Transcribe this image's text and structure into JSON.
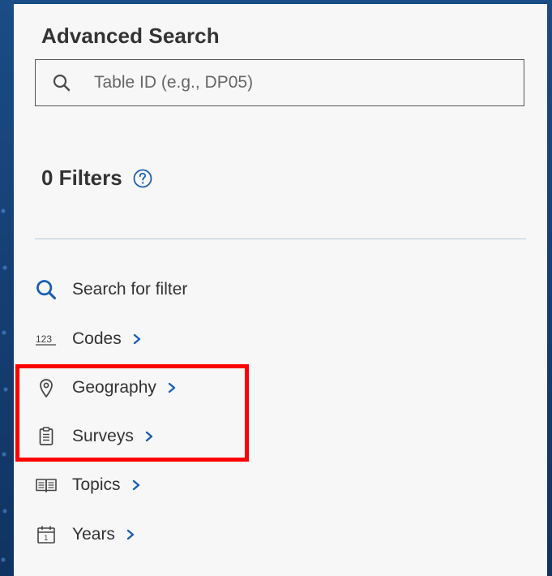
{
  "panel": {
    "title": "Advanced Search"
  },
  "search": {
    "placeholder": "Table ID (e.g., DP05)",
    "value": "",
    "icon": "search-icon"
  },
  "filters": {
    "heading": "0 Filters",
    "help_icon": "help-circle-icon"
  },
  "filter_items": [
    {
      "label": "Search for filter",
      "icon": "search-icon",
      "has_chevron": false
    },
    {
      "label": "Codes",
      "icon": "numeric-codes-icon",
      "has_chevron": true
    },
    {
      "label": "Geography",
      "icon": "map-pin-icon",
      "has_chevron": true
    },
    {
      "label": "Surveys",
      "icon": "clipboard-icon",
      "has_chevron": true
    },
    {
      "label": "Topics",
      "icon": "open-book-icon",
      "has_chevron": true
    },
    {
      "label": "Years",
      "icon": "calendar-icon",
      "has_chevron": true
    }
  ],
  "codes_icon_text": "123",
  "calendar_icon_text": "1",
  "colors": {
    "accent_blue": "#1a5fb4",
    "text": "#333333",
    "highlight_red": "#ff0000",
    "divider": "#b9c9da",
    "panel_bg": "#f7f7f7"
  },
  "annotation": {
    "highlight": "red box around Geography and Surveys"
  }
}
